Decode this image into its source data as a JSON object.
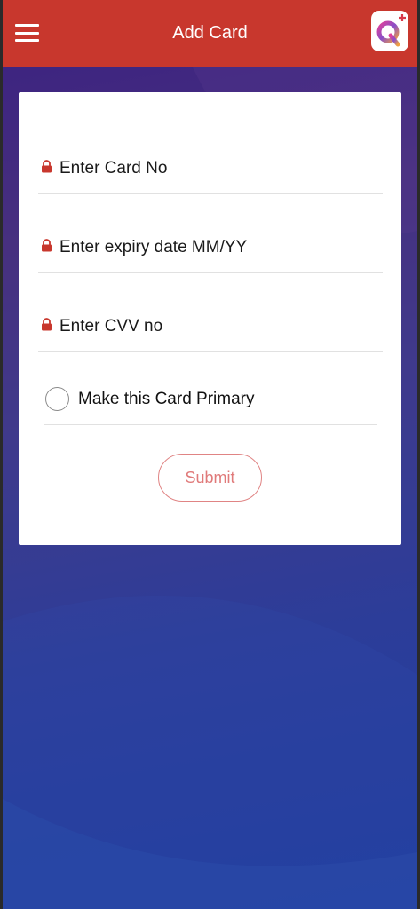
{
  "header": {
    "title": "Add Card",
    "menu_icon": "hamburger-menu-icon",
    "logo_icon": "q-plus-logo-icon",
    "background_color": "#c8372d"
  },
  "form": {
    "card_number": {
      "placeholder": "Enter Card No",
      "value": "",
      "icon": "lock-icon"
    },
    "expiry": {
      "placeholder": "Enter expiry date MM/YY",
      "value": "",
      "icon": "lock-icon"
    },
    "cvv": {
      "placeholder": "Enter CVV no",
      "value": "",
      "icon": "lock-icon"
    },
    "primary_option": {
      "label": "Make this Card Primary",
      "checked": false
    },
    "submit_label": "Submit"
  },
  "colors": {
    "accent": "#c8372d",
    "submit_text": "#e07a7a",
    "background_top": "#3a2080",
    "background_bottom": "#203f9f"
  }
}
